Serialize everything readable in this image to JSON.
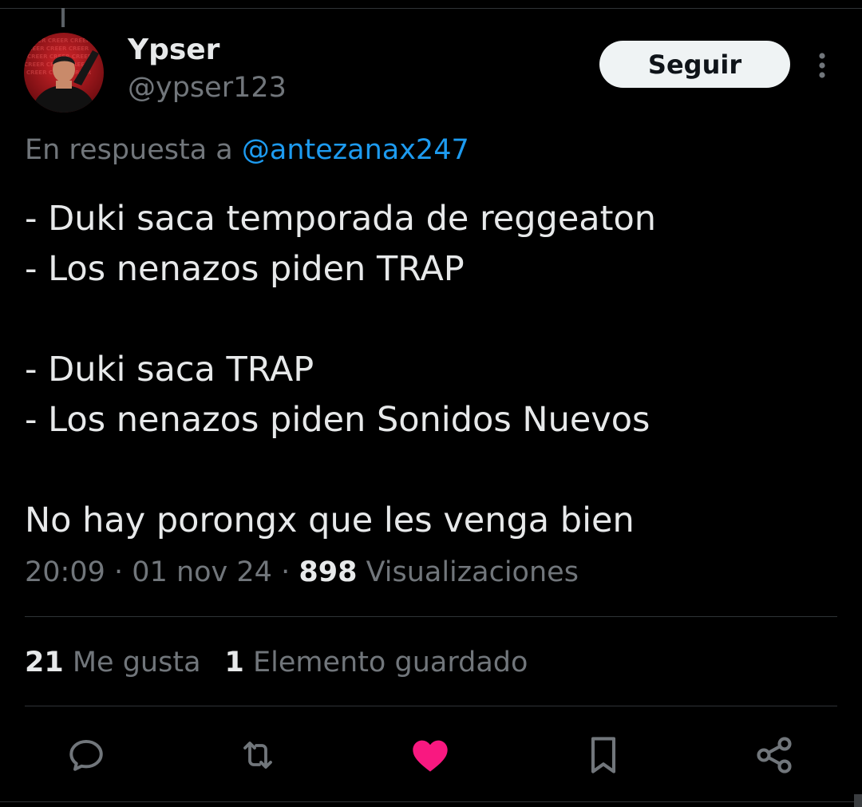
{
  "tweet": {
    "author": {
      "name": "Ypser",
      "handle": "@ypser123"
    },
    "follow_label": "Seguir",
    "reply_prefix": "En respuesta a",
    "reply_mention": "@antezanax247",
    "lines": [
      "- Duki saca temporada de reggeaton",
      "- Los nenazos piden TRAP",
      "",
      "- Duki saca TRAP",
      "- Los nenazos piden Sonidos Nuevos",
      "",
      "No hay porongx que les venga bien"
    ],
    "time": "20:09",
    "date": "01 nov 24",
    "separator": "·",
    "views_count": "898",
    "views_label": "Visualizaciones",
    "likes_count": "21",
    "likes_label": "Me gusta",
    "bookmarks_count": "1",
    "bookmarks_label": "Elemento guardado"
  },
  "icons": {
    "more": "more-dots-icon",
    "reply": "reply-bubble-icon",
    "retweet": "retweet-icon",
    "like": "heart-icon",
    "bookmark": "bookmark-icon",
    "share": "share-icon"
  },
  "colors": {
    "background": "#000000",
    "text": "#e7e9ea",
    "muted": "#71767b",
    "link": "#1d9bf0",
    "like_active": "#f91880",
    "button_bg": "#eff3f4"
  }
}
